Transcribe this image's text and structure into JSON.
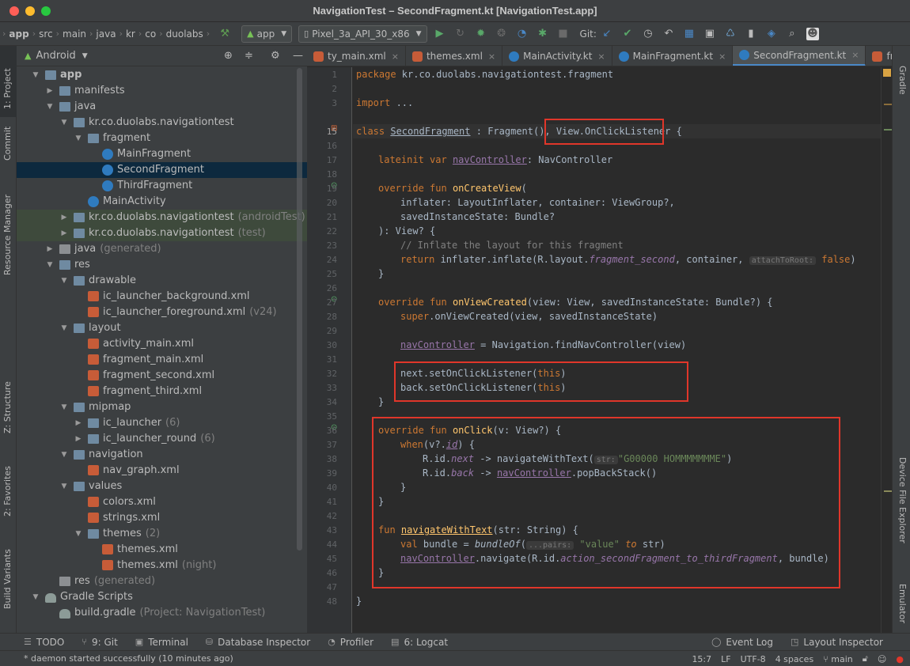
{
  "window": {
    "title": "NavigationTest – SecondFragment.kt [NavigationTest.app]"
  },
  "toolbar": {
    "breadcrumbs": [
      "app",
      "src",
      "main",
      "java",
      "kr",
      "co",
      "duolabs"
    ],
    "run_config": "app",
    "device": "Pixel_3a_API_30_x86",
    "git_label": "Git:"
  },
  "left_strip": {
    "tabs": [
      "1: Project",
      "Commit",
      "Resource Manager",
      "Z: Structure",
      "2: Favorites",
      "Build Variants"
    ]
  },
  "right_strip": {
    "tabs": [
      "Gradle",
      "Device File Explorer",
      "Emulator"
    ]
  },
  "project": {
    "view_selector": "Android",
    "tree": [
      {
        "label": "app",
        "suffix": "",
        "icon": "module-icon",
        "arrow": "down"
      },
      {
        "label": "manifests",
        "suffix": "",
        "icon": "folder-icon",
        "arrow": "right"
      },
      {
        "label": "java",
        "suffix": "",
        "icon": "folder-icon",
        "arrow": "down"
      },
      {
        "label": "kr.co.duolabs.navigationtest",
        "suffix": "",
        "icon": "package-icon",
        "arrow": "down"
      },
      {
        "label": "fragment",
        "suffix": "",
        "icon": "package-icon",
        "arrow": "down"
      },
      {
        "label": "MainFragment",
        "suffix": "",
        "icon": "kotlin-class-icon",
        "arrow": ""
      },
      {
        "label": "SecondFragment",
        "suffix": "",
        "icon": "kotlin-class-icon",
        "arrow": ""
      },
      {
        "label": "ThirdFragment",
        "suffix": "",
        "icon": "kotlin-class-icon",
        "arrow": ""
      },
      {
        "label": "MainActivity",
        "suffix": "",
        "icon": "kotlin-class-icon",
        "arrow": ""
      },
      {
        "label": "kr.co.duolabs.navigationtest",
        "suffix": "(androidTest)",
        "icon": "package-icon",
        "arrow": "right"
      },
      {
        "label": "kr.co.duolabs.navigationtest",
        "suffix": "(test)",
        "icon": "package-icon",
        "arrow": "right"
      },
      {
        "label": "java",
        "suffix": "(generated)",
        "icon": "folder-icon",
        "arrow": "right"
      },
      {
        "label": "res",
        "suffix": "",
        "icon": "folder-icon",
        "arrow": "down"
      },
      {
        "label": "drawable",
        "suffix": "",
        "icon": "folder-icon",
        "arrow": "down"
      },
      {
        "label": "ic_launcher_background.xml",
        "suffix": "",
        "icon": "xml-file-icon",
        "arrow": ""
      },
      {
        "label": "ic_launcher_foreground.xml",
        "suffix": "(v24)",
        "icon": "xml-file-icon",
        "arrow": ""
      },
      {
        "label": "layout",
        "suffix": "",
        "icon": "folder-icon",
        "arrow": "down"
      },
      {
        "label": "activity_main.xml",
        "suffix": "",
        "icon": "xml-file-icon",
        "arrow": ""
      },
      {
        "label": "fragment_main.xml",
        "suffix": "",
        "icon": "xml-file-icon",
        "arrow": ""
      },
      {
        "label": "fragment_second.xml",
        "suffix": "",
        "icon": "xml-file-icon",
        "arrow": ""
      },
      {
        "label": "fragment_third.xml",
        "suffix": "",
        "icon": "xml-file-icon",
        "arrow": ""
      },
      {
        "label": "mipmap",
        "suffix": "",
        "icon": "folder-icon",
        "arrow": "down"
      },
      {
        "label": "ic_launcher",
        "suffix": "(6)",
        "icon": "folder-icon",
        "arrow": "right"
      },
      {
        "label": "ic_launcher_round",
        "suffix": "(6)",
        "icon": "folder-icon",
        "arrow": "right"
      },
      {
        "label": "navigation",
        "suffix": "",
        "icon": "folder-icon",
        "arrow": "down"
      },
      {
        "label": "nav_graph.xml",
        "suffix": "",
        "icon": "xml-file-icon",
        "arrow": ""
      },
      {
        "label": "values",
        "suffix": "",
        "icon": "folder-icon",
        "arrow": "down"
      },
      {
        "label": "colors.xml",
        "suffix": "",
        "icon": "xml-file-icon",
        "arrow": ""
      },
      {
        "label": "strings.xml",
        "suffix": "",
        "icon": "xml-file-icon",
        "arrow": ""
      },
      {
        "label": "themes",
        "suffix": "(2)",
        "icon": "folder-icon",
        "arrow": "down"
      },
      {
        "label": "themes.xml",
        "suffix": "",
        "icon": "xml-file-icon",
        "arrow": ""
      },
      {
        "label": "themes.xml",
        "suffix": "(night)",
        "icon": "xml-file-icon",
        "arrow": ""
      },
      {
        "label": "res",
        "suffix": "(generated)",
        "icon": "folder-icon",
        "arrow": ""
      },
      {
        "label": "Gradle Scripts",
        "suffix": "",
        "icon": "gradle-icon",
        "arrow": "down"
      },
      {
        "label": "build.gradle",
        "suffix": "(Project: NavigationTest)",
        "icon": "gradle-icon",
        "arrow": ""
      }
    ]
  },
  "editor_tabs": [
    {
      "label": "ty_main.xml",
      "icon": "xml-file-icon",
      "active": false
    },
    {
      "label": "themes.xml",
      "icon": "xml-file-icon",
      "active": false
    },
    {
      "label": "MainActivity.kt",
      "icon": "kotlin-class-icon",
      "active": false
    },
    {
      "label": "MainFragment.kt",
      "icon": "kotlin-class-icon",
      "active": false
    },
    {
      "label": "SecondFragment.kt",
      "icon": "kotlin-class-icon",
      "active": true
    },
    {
      "label": "fragmer",
      "icon": "xml-file-icon",
      "active": false
    }
  ],
  "code": {
    "line_numbers": [
      "1",
      "2",
      "3",
      "15",
      "16",
      "17",
      "18",
      "19",
      "20",
      "21",
      "22",
      "23",
      "24",
      "25",
      "26",
      "27",
      "28",
      "29",
      "30",
      "31",
      "32",
      "33",
      "34",
      "35",
      "36",
      "37",
      "38",
      "39",
      "40",
      "41",
      "42",
      "43",
      "44",
      "45",
      "46",
      "47",
      "48"
    ],
    "lines": {
      "l1_kw": "package",
      "l1_rest": " kr.co.duolabs.navigationtest.fragment",
      "l3_kw": "import",
      "l3_rest": " ...",
      "l15_kw": "class",
      "l15_name": "SecondFragment",
      "l15_rest": " : Fragment(), ",
      "l15_iface": "View.OnClickListener",
      "l15_end": " {",
      "l17_kw": "lateinit var",
      "l17_prop": "navController",
      "l17_rest": ": NavController",
      "l19_kw": "override fun",
      "l19_fn": "onCreateView",
      "l19_rest": "(",
      "l20": "inflater: LayoutInflater, container: ViewGroup?,",
      "l21": "savedInstanceState: Bundle?",
      "l22": "): View? {",
      "l23": "// Inflate the layout for this fragment",
      "l24_kw": "return",
      "l24_a": " inflater.inflate(R.layout.",
      "l24_prop": "fragment_second",
      "l24_b": ", container, ",
      "l24_hint": "attachToRoot:",
      "l24_false": "false",
      "l24_c": ")",
      "l25": "}",
      "l27_kw": "override fun",
      "l27_fn": "onViewCreated",
      "l27_rest": "(view: View, savedInstanceState: Bundle?) {",
      "l28_kw": "super",
      "l28_rest": ".onViewCreated(view, savedInstanceState)",
      "l30_prop": "navController",
      "l30_rest": " = Navigation.findNavController(view)",
      "l32_a": "next.setOnClickListener(",
      "l32_kw": "this",
      "l32_b": ")",
      "l33_a": "back.setOnClickListener(",
      "l33_kw": "this",
      "l33_b": ")",
      "l34": "}",
      "l36_kw": "override fun",
      "l36_fn": "onClick",
      "l36_rest": "(v: View?) {",
      "l37_kw": "when",
      "l37_a": "(v?.",
      "l37_prop": "id",
      "l37_b": ") {",
      "l38_a": "R.id.",
      "l38_prop": "next",
      "l38_b": " -> navigateWithText(",
      "l38_hint": "str:",
      "l38_str": "\"G00000 HOMMMMMMME\"",
      "l38_c": ")",
      "l39_a": "R.id.",
      "l39_prop": "back",
      "l39_b": " -> ",
      "l39_nav": "navController",
      "l39_c": ".popBackStack()",
      "l40": "}",
      "l41": "}",
      "l43_kw": "fun",
      "l43_fn": "navigateWithText",
      "l43_rest": "(str: String) {",
      "l44_kw": "val",
      "l44_a": " bundle = ",
      "l44_fn": "bundleOf",
      "l44_b": "(",
      "l44_hint": "...pairs:",
      "l44_str": "\"value\"",
      "l44_to": " to",
      "l44_c": " str)",
      "l45_nav": "navController",
      "l45_a": ".navigate(R.id.",
      "l45_prop": "action_secondFragment_to_thirdFragment",
      "l45_b": ", bundle)",
      "l46": "}",
      "l48": "}"
    }
  },
  "bottom_tabs": [
    {
      "label": "TODO",
      "icon": "list-icon"
    },
    {
      "label": "9: Git",
      "icon": "git-icon"
    },
    {
      "label": "Terminal",
      "icon": "terminal-icon"
    },
    {
      "label": "Database Inspector",
      "icon": "database-icon"
    },
    {
      "label": "Profiler",
      "icon": "profiler-icon"
    },
    {
      "label": "6: Logcat",
      "icon": "logcat-icon"
    },
    {
      "label": "Event Log",
      "icon": "event-log-icon"
    },
    {
      "label": "Layout Inspector",
      "icon": "layout-inspector-icon"
    }
  ],
  "status": {
    "message": "* daemon started successfully (10 minutes ago)",
    "position": "15:7",
    "line_sep": "LF",
    "encoding": "UTF-8",
    "indent": "4 spaces",
    "branch": "main"
  }
}
